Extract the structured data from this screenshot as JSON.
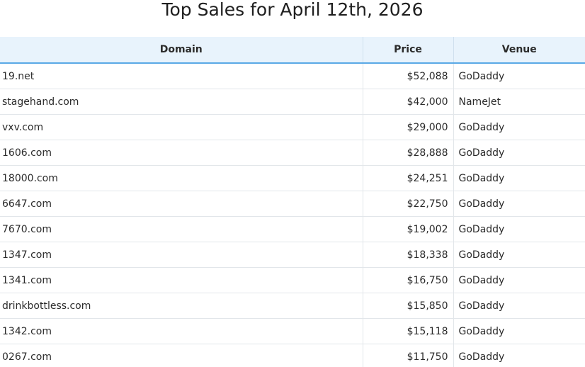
{
  "page": {
    "title": "Top Sales for April 12th, 2026"
  },
  "table": {
    "headers": {
      "domain": "Domain",
      "price": "Price",
      "venue": "Venue"
    },
    "rows": [
      {
        "domain": "19.net",
        "price": "$52,088",
        "venue": "GoDaddy"
      },
      {
        "domain": "stagehand.com",
        "price": "$42,000",
        "venue": "NameJet"
      },
      {
        "domain": "vxv.com",
        "price": "$29,000",
        "venue": "GoDaddy"
      },
      {
        "domain": "1606.com",
        "price": "$28,888",
        "venue": "GoDaddy"
      },
      {
        "domain": "18000.com",
        "price": "$24,251",
        "venue": "GoDaddy"
      },
      {
        "domain": "6647.com",
        "price": "$22,750",
        "venue": "GoDaddy"
      },
      {
        "domain": "7670.com",
        "price": "$19,002",
        "venue": "GoDaddy"
      },
      {
        "domain": "1347.com",
        "price": "$18,338",
        "venue": "GoDaddy"
      },
      {
        "domain": "1341.com",
        "price": "$16,750",
        "venue": "GoDaddy"
      },
      {
        "domain": "drinkbottless.com",
        "price": "$15,850",
        "venue": "GoDaddy"
      },
      {
        "domain": "1342.com",
        "price": "$15,118",
        "venue": "GoDaddy"
      },
      {
        "domain": "0267.com",
        "price": "$11,750",
        "venue": "GoDaddy"
      }
    ]
  }
}
